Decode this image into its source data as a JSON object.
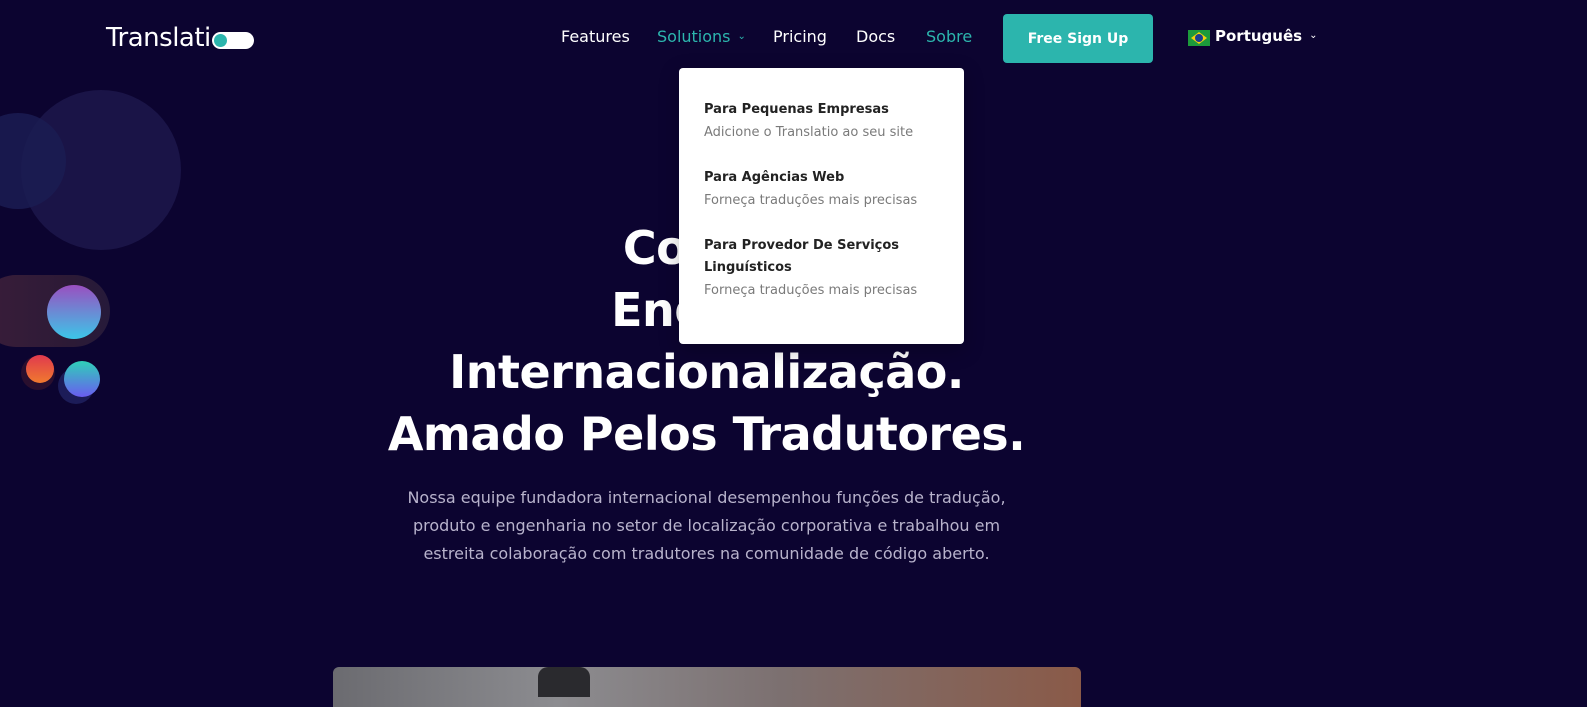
{
  "brand": {
    "name": "Translati"
  },
  "nav": {
    "items": [
      {
        "label": "Features"
      },
      {
        "label": "Solutions"
      },
      {
        "label": "Pricing"
      },
      {
        "label": "Docs"
      },
      {
        "label": "Sobre"
      }
    ],
    "cta_label": "Free Sign Up",
    "language_label": "Português"
  },
  "dropdown": {
    "items": [
      {
        "title": "Para Pequenas Empresas",
        "desc": "Adicione o Translatio ao seu site"
      },
      {
        "title": "Para Agências Web",
        "desc": "Forneça traduções mais precisas"
      },
      {
        "title": "Para Provedor De Serviços Linguísticos",
        "desc": "Forneça traduções mais precisas"
      }
    ]
  },
  "hero": {
    "line1": "Constr",
    "line2": "Engenh",
    "line3": "Internacionalização.",
    "line4": "Amado Pelos Tradutores.",
    "subtitle": "Nossa equipe fundadora internacional desempenhou funções de tradução, produto e engenharia no setor de localização corporativa e trabalhou em estreita colaboração com tradutores na comunidade de código aberto."
  },
  "colors": {
    "background": "#0c0430",
    "accent": "#2cb5ad"
  },
  "icons": [
    "chevron-down-icon",
    "brazil-flag-icon"
  ]
}
